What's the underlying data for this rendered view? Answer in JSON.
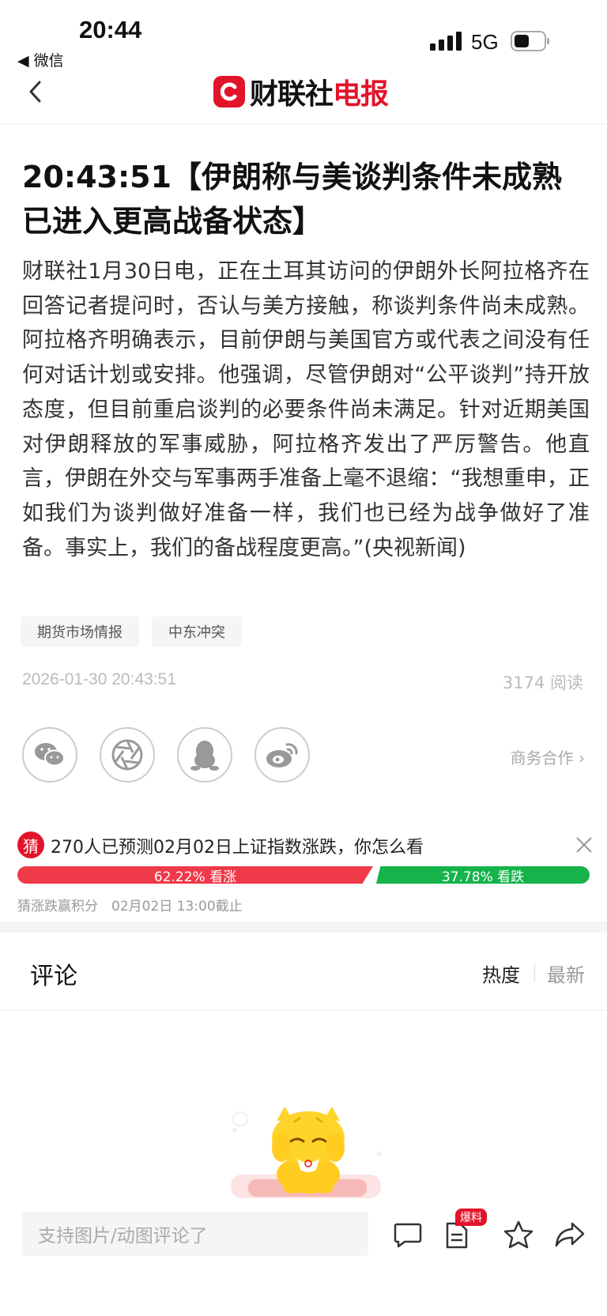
{
  "status_bar": {
    "time": "20:44",
    "network": "5G",
    "back_app": "◀ 微信"
  },
  "nav": {
    "logo_part1": "财联社",
    "logo_part2": "电报"
  },
  "article": {
    "title": "20:43:51【伊朗称与美谈判条件未成熟 已进入更高战备状态】",
    "body": "财联社1月30日电，正在土耳其访问的伊朗外长阿拉格齐在回答记者提问时，否认与美方接触，称谈判条件尚未成熟。阿拉格齐明确表示，目前伊朗与美国官方或代表之间没有任何对话计划或安排。他强调，尽管伊朗对“公平谈判”持开放态度，但目前重启谈判的必要条件尚未满足。针对近期美国对伊朗释放的军事威胁，阿拉格齐发出了严厉警告。他直言，伊朗在外交与军事两手准备上毫不退缩：“我想重申，正如我们为谈判做好准备一样，我们也已经为战争做好了准备。事实上，我们的备战程度更高。”(央视新闻)",
    "tags": [
      "期货市场情报",
      "中东冲突"
    ],
    "date": "2026-01-30 20:43:51",
    "reads": "3174 阅读",
    "business": "商务合作 ›"
  },
  "prediction": {
    "badge": "猜",
    "question": "270人已预测02月02日上证指数涨跌，你怎么看",
    "up_label": "62.22% 看涨",
    "down_label": "37.78% 看跌",
    "up_fraction": 0.6222,
    "footer": "猜涨跌赢积分　02月02日 13:00截止"
  },
  "comments": {
    "title": "评论",
    "sort_hot": "热度",
    "sort_new": "最新"
  },
  "bottom_bar": {
    "placeholder": "支持图片/动图评论了",
    "baoliao": "爆料"
  },
  "colors": {
    "brand": "#e2142a",
    "up": "#ef3a4a",
    "down": "#15b34a"
  }
}
